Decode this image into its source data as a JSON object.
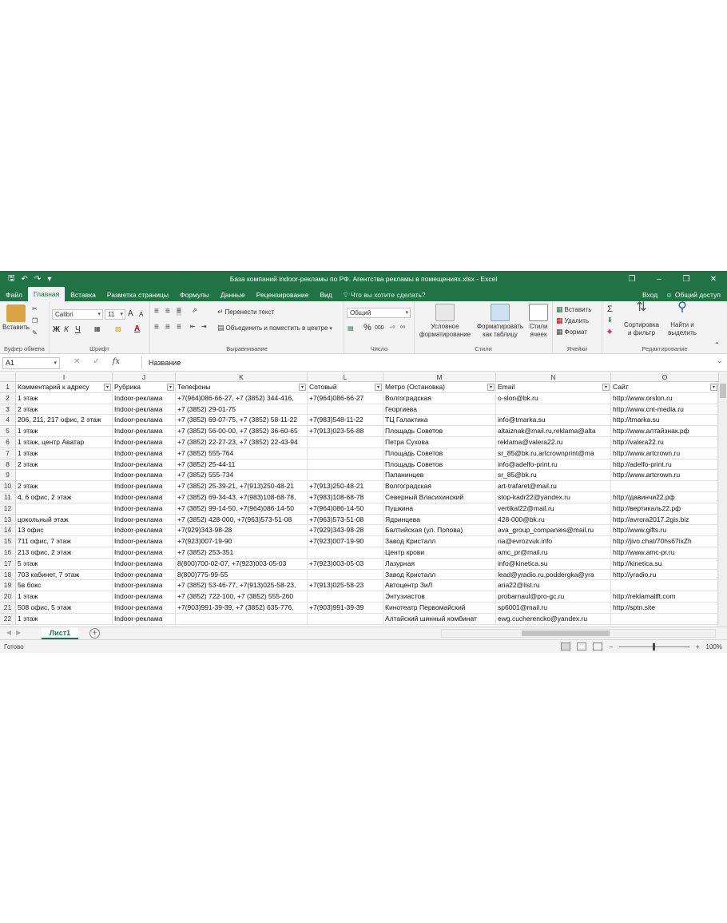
{
  "app": {
    "title": "База компаний indoor-рекламы по РФ. Агентства рекламы в помещениях.xlsx - Excel",
    "login": "Вход",
    "share": "Общий доступ"
  },
  "tabs": [
    "Файл",
    "Главная",
    "Вставка",
    "Разметка страницы",
    "Формулы",
    "Данные",
    "Рецензирование",
    "Вид"
  ],
  "tell_me": "Что вы хотите сделать?",
  "ribbon": {
    "paste": "Вставить",
    "clipboard_label": "Буфер обмена",
    "font_name": "Calibri",
    "font_size": "11",
    "font_grow": "A",
    "font_shrink": "A",
    "bold": "Ж",
    "italic": "К",
    "underline": "Ч",
    "font_label": "Шрифт",
    "wrap_text": "Перенести текст",
    "merge_center": "Объединить и поместить в центре",
    "align_label": "Выравнивание",
    "number_format": "Общий",
    "percent": "%",
    "thousands": "000",
    "dec_inc": "⁺⁰",
    "dec_dec": "⁰⁰",
    "number_label": "Число",
    "conditional_1": "Условное",
    "conditional_2": "форматирование",
    "format_table_1": "Форматировать",
    "format_table_2": "как таблицу",
    "cell_styles_1": "Стили",
    "cell_styles_2": "ячеек",
    "styles_label": "Стили",
    "insert": "Вставить",
    "delete": "Удалить",
    "format": "Формат",
    "cells_label": "Ячейки",
    "sort_1": "Сортировка",
    "sort_2": "и фильтр",
    "find_1": "Найти и",
    "find_2": "выделить",
    "editing_label": "Редактирование"
  },
  "formula_bar": {
    "name_box": "A1",
    "fx": "fx",
    "content": "Название"
  },
  "columns": [
    "I",
    "J",
    "K",
    "L",
    "M",
    "N",
    "O"
  ],
  "header_row": [
    "Комментарий к адресу",
    "Рубрика",
    "Телефоны",
    "Сотовый",
    "Метро (Остановка)",
    "Email",
    "Сайт"
  ],
  "rows": [
    [
      "1 этаж",
      "Indoor-реклама",
      "+7(964)086-66-27, +7 (3852) 344-416,",
      "+7(964)086-66-27",
      "Волгоградская",
      "o-slon@bk.ru",
      "http://www.orslon.ru"
    ],
    [
      "2 этаж",
      "Indoor-реклама",
      "+7 (3852) 29-01-75",
      "",
      "Георгиева",
      "",
      "http://www.cnt-media.ru"
    ],
    [
      "206, 211, 217 офис, 2 этаж",
      "Indoor-реклама",
      "+7 (3852) 69-07-75, +7 (3852) 58-11-22",
      "+7(983)548-11-22",
      "ТЦ Галактика",
      "info@tmarka.su",
      "http://tmarka.su"
    ],
    [
      "1 этаж",
      "Indoor-реклама",
      "+7 (3852) 56-00-00, +7 (3852) 36-60-65",
      "+7(913)023-56-88",
      "Площадь Советов",
      "altaiznak@mail.ru,reklama@alta",
      "http://www.алтайзнак.рф"
    ],
    [
      "1 этаж, центр Аватар",
      "Indoor-реклама",
      "+7 (3852) 22-27-23, +7 (3852) 22-43-94",
      "",
      "Петра Сухова",
      "reklama@valera22.ru",
      "http://valera22.ru"
    ],
    [
      "1 этаж",
      "Indoor-реклама",
      "+7 (3852) 555-764",
      "",
      "Площадь Советов",
      "sr_85@bk.ru,artcrownprint@ma",
      "http://www.artcrown.ru"
    ],
    [
      "2 этаж",
      "Indoor-реклама",
      "+7 (3852) 25-44-11",
      "",
      "Площадь Советов",
      "info@adelfo-print.ru",
      "http://adelfo-print.ru"
    ],
    [
      "",
      "Indoor-реклама",
      "+7 (3852) 555-734",
      "",
      "Папанинцев",
      "sr_85@bk.ru",
      "http://www.artcrown.ru"
    ],
    [
      "2 этаж",
      "Indoor-реклама",
      "+7 (3852) 25-39-21, +7(913)250-48-21",
      "+7(913)250-48-21",
      "Волгоградская",
      "art-trafaret@mail.ru",
      ""
    ],
    [
      "4, 6 офис, 2 этаж",
      "Indoor-реклама",
      "+7 (3852) 69-34-43, +7(983)108-68-78,",
      "+7(983)108-68-78",
      "Северный Власихинский",
      "stop-kadr22@yandex.ru",
      "http://давинчи22.рф"
    ],
    [
      "",
      "Indoor-реклама",
      "+7 (3852) 99-14-50, +7(964)086-14-50",
      "+7(964)086-14-50",
      "Пушкина",
      "vertikal22@mail.ru",
      "http://вертикаль22.рф"
    ],
    [
      "цокольный этаж",
      "Indoor-реклама",
      "+7 (3852) 428-000, +7(963)573-51-08",
      "+7(963)573-51-08",
      "Ядринцева",
      "428-000@bk.ru",
      "http://avrora2017.2gis.biz"
    ],
    [
      "13 офис",
      "Indoor-реклама",
      "+7(929)343-98-28",
      "+7(929)343-98-28",
      "Балтийская (ул. Попова)",
      "ava_group_companies@mail.ru",
      "http://www.gifts.ru"
    ],
    [
      "711 офис, 7 этаж",
      "Indoor-реклама",
      "+7(923)007-19-90",
      "+7(923)007-19-90",
      "Завод Кристалл",
      "ria@evrozvuk.info",
      "http://jivo.chat/70hs67ixZh"
    ],
    [
      "213 офис, 2 этаж",
      "Indoor-реклама",
      "+7 (3852) 253-351",
      "",
      "Центр крови",
      "amc_pr@mail.ru",
      "http://www.amc-pr.ru"
    ],
    [
      "5 этаж",
      "Indoor-реклама",
      "8(800)700-02-07, +7(923)003-05-03",
      "+7(923)003-05-03",
      "Лазурная",
      "info@kinetica.su",
      "http://kinetica.su"
    ],
    [
      "703 кабинет, 7 этаж",
      "Indoor-реклама",
      "8(800)775-99-55",
      "",
      "Завод Кристалл",
      "lead@yradio.ru,poddergka@yra",
      "http://yradio.ru"
    ],
    [
      "5в бокс",
      "Indoor-реклама",
      "+7 (3852) 53-46-77, +7(913)025-58-23,",
      "+7(913)025-58-23",
      "Автоцентр ЗиЛ",
      "aria22@list.ru",
      ""
    ],
    [
      "1 этаж",
      "Indoor-реклама",
      "+7 (3852) 722-100, +7 (3852) 555-260",
      "",
      "Энтузиастов",
      "probarnaul@pro-gc.ru",
      "http://reklamalift.com"
    ],
    [
      "508 офис, 5 этаж",
      "Indoor-реклама",
      "+7(903)991-39-39, +7 (3852) 635-776,",
      "+7(903)991-39-39",
      "Кинотеатр Первомайский",
      "sp6001@mail.ru",
      "http://sptn.site"
    ],
    [
      "1 этаж",
      "Indoor-реклама",
      "",
      "",
      "Алтайский шинный комбинат",
      "ewg.cucherencko@yandex.ru",
      ""
    ]
  ],
  "sheet": {
    "name": "Лист1",
    "add": "+"
  },
  "status": {
    "ready": "Готово",
    "zoom": "100%"
  },
  "colors": {
    "accent": "#217346"
  }
}
